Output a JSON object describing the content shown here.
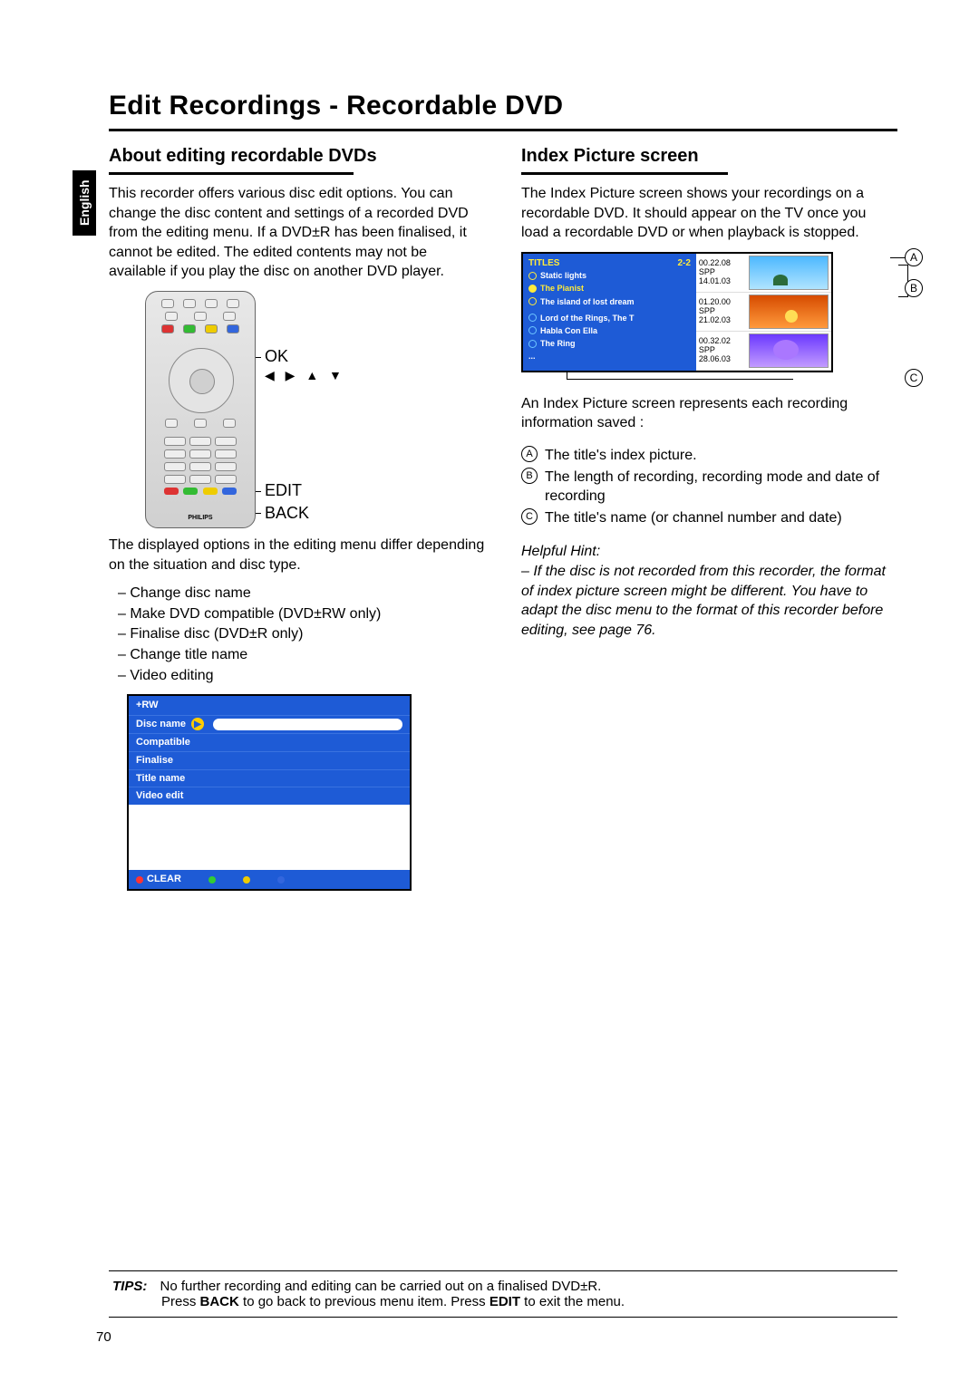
{
  "lang_tab": "English",
  "main_title": "Edit Recordings - Recordable DVD",
  "left": {
    "heading": "About editing recordable DVDs",
    "intro": "This recorder offers various disc edit options. You can change the disc content and settings of a recorded DVD from the editing menu. If a DVD±R has been finalised, it cannot be edited. The edited contents may not be available if you play the disc on another DVD player.",
    "remote_ok": "OK",
    "remote_arrows": "◀ ▶ ▲ ▼",
    "remote_edit": "EDIT",
    "remote_back": "BACK",
    "options_intro": "The displayed options in the editing menu differ depending on the situation and disc type.",
    "bullets": [
      "Change disc name",
      "Make DVD compatible (DVD±RW only)",
      "Finalise disc (DVD±R only)",
      "Change title name",
      "Video editing"
    ],
    "menu": {
      "header": "+RW",
      "items": [
        "Disc name",
        "Compatible",
        "Finalise",
        "Title name",
        "Video edit"
      ],
      "footer_clear": "CLEAR"
    }
  },
  "right": {
    "heading": "Index Picture screen",
    "intro": "The Index Picture screen shows your recordings on a recordable DVD.  It should appear on the TV once you load a recordable DVD or when playback is stopped.",
    "screen": {
      "titles_label": "TITLES",
      "titles_count": "2-2",
      "rows_top": [
        "Static lights",
        "The Pianist",
        "The island of lost dream"
      ],
      "rows_bot": [
        "Lord of the Rings, The T",
        "Habla Con Ella",
        "The Ring"
      ],
      "dots": "...",
      "thumbs": [
        {
          "dur": "00.22.08",
          "mode": "SPP",
          "date": "14.01.03"
        },
        {
          "dur": "01.20.00",
          "mode": "SPP",
          "date": "21.02.03"
        },
        {
          "dur": "00.32.02",
          "mode": "SPP",
          "date": "28.06.03"
        }
      ],
      "callouts": {
        "a": "A",
        "b": "B",
        "c": "C"
      }
    },
    "legend_intro": "An Index Picture screen represents each recording information saved :",
    "legend": {
      "a": "The title's index picture.",
      "b": "The length of recording, recording mode and date of recording",
      "c": "The title's name (or channel number and date)"
    },
    "hint_label": "Helpful Hint:",
    "hint_body": "– If the disc is not recorded from this recorder, the format of index picture screen might be different. You have to adapt the disc menu to the format of this recorder before editing, see page 76."
  },
  "tips": {
    "label": "TIPS:",
    "line1": "No further recording and editing can be carried out on a finalised DVD±R.",
    "line2_a": "Press ",
    "line2_back": "BACK",
    "line2_b": " to go back to previous menu item. Press ",
    "line2_edit": "EDIT",
    "line2_c": " to exit the menu."
  },
  "page_number": "70"
}
